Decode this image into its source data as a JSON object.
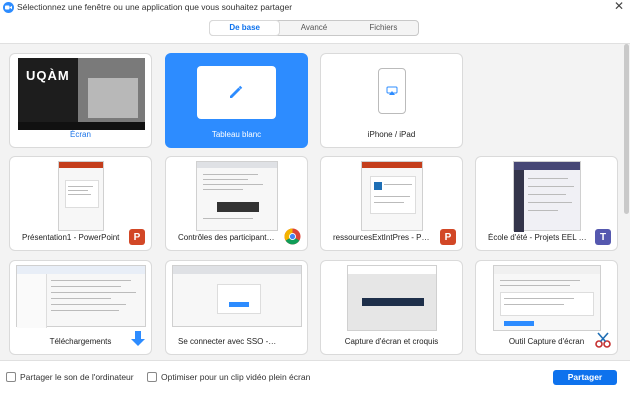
{
  "titlebar": {
    "title": "Sélectionnez une fenêtre ou une application que vous souhaitez partager",
    "close": "✕"
  },
  "tabs": [
    {
      "label": "De base",
      "active": true
    },
    {
      "label": "Avancé",
      "active": false
    },
    {
      "label": "Fichiers",
      "active": false
    }
  ],
  "cards": {
    "screen": {
      "label": "Écran",
      "brand": "UQÀM"
    },
    "whiteboard": {
      "label": "Tableau blanc"
    },
    "iphone": {
      "label": "iPhone / iPad"
    },
    "ppt1": {
      "label": "Présentation1 - PowerPoint",
      "badge": "P"
    },
    "chrome": {
      "label": "Contrôles des participants penda..."
    },
    "ppt2": {
      "label": "ressourcesExtIntPres - PowerPoint",
      "badge": "P"
    },
    "teams": {
      "label": "École d'été - Projets EEL UQAM |...",
      "badge": "T"
    },
    "downloads": {
      "label": "Téléchargements"
    },
    "zoom": {
      "label": "Se connecter avec SSO - Zoom - ..."
    },
    "snip": {
      "label": "Capture d'écran et croquis"
    },
    "snippingtool": {
      "label": "Outil Capture d'écran"
    }
  },
  "bottom": {
    "share_sound": "Partager le son de l'ordinateur",
    "optimize_video": "Optimiser pour un clip vidéo plein écran",
    "share_button": "Partager"
  },
  "colors": {
    "accent": "#0e72ed",
    "selected_card": "#2d8cff",
    "powerpoint": "#d24726",
    "teams": "#5558af"
  }
}
